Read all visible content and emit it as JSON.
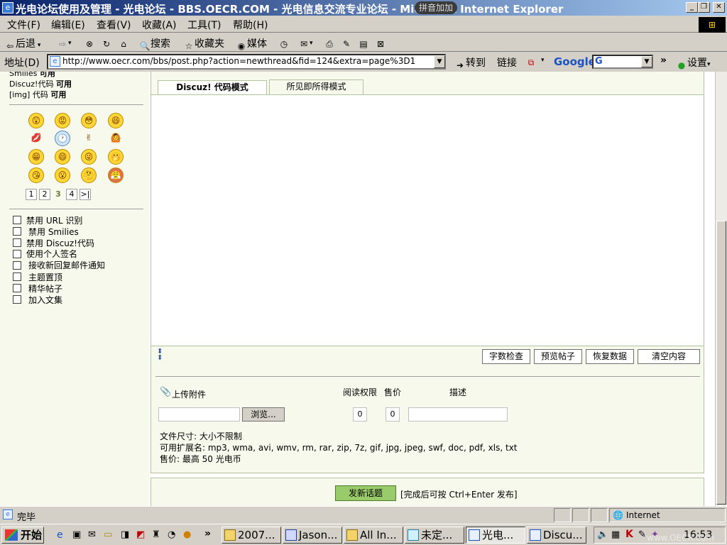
{
  "window": {
    "title": "光电论坛使用及管理 - 光电论坛 - BBS.OECR.COM - 光电信息交流专业论坛 - Microsoft Internet Explorer",
    "ime_label": "拼音加加"
  },
  "menu": [
    "文件(F)",
    "编辑(E)",
    "查看(V)",
    "收藏(A)",
    "工具(T)",
    "帮助(H)"
  ],
  "toolbar": {
    "back": "后退",
    "search": "搜索",
    "favorites": "收藏夹",
    "media": "媒体"
  },
  "address": {
    "label": "地址(D)",
    "url": "http://www.oecr.com/bbs/post.php?action=newthread&fid=124&extra=page%3D1",
    "go": "转到",
    "links": "链接",
    "google": "Google",
    "settings": "设置"
  },
  "sidebar": {
    "status": [
      {
        "name": "Smilies",
        "value": "可用"
      },
      {
        "name": "Discuz!代码",
        "value": "可用"
      },
      {
        "name": "[img] 代码",
        "value": "可用"
      }
    ],
    "smilies": [
      "😲",
      "😡",
      "😳",
      "😆",
      "💋",
      "🕐",
      "✌",
      "🙆",
      "😁",
      "😄",
      "😜",
      "🤭",
      "😘",
      "😮",
      "🤔",
      "😤"
    ],
    "pages": [
      "1",
      "2",
      "3",
      "4",
      ">|"
    ],
    "current_page": "3",
    "options": [
      "禁用 URL 识别",
      "禁用 Smilies",
      "禁用 Discuz!代码",
      "使用个人签名",
      "接收新回复邮件通知",
      "主题置顶",
      "精华帖子",
      "加入文集"
    ]
  },
  "editor": {
    "tab_code": "Discuz! 代码模式",
    "tab_wysiwyg": "所见即所得模式",
    "buttons": {
      "count": "字数检查",
      "preview": "预览帖子",
      "restore": "恢复数据",
      "clear": "清空内容"
    }
  },
  "attachment": {
    "label": "上传附件",
    "col_perm": "阅读权限",
    "col_price": "售价",
    "col_desc": "描述",
    "browse": "浏览...",
    "perm_value": "0",
    "price_value": "0",
    "info": [
      "文件尺寸: 大小不限制",
      "可用扩展名: mp3, wma, avi, wmv, rm, rar, zip, 7z, gif, jpg, jpeg, swf, doc, pdf, xls, txt",
      "售价: 最高 50 光电币"
    ]
  },
  "submit": {
    "button": "发新话题",
    "hint": "[完成后可按 Ctrl+Enter 发布]"
  },
  "status": {
    "text": "完毕",
    "zone": "Internet"
  },
  "taskbar": {
    "start": "开始",
    "tasks": [
      "2007...",
      "Jason...",
      "All In...",
      "未定...",
      "光电...",
      "Discu..."
    ],
    "active_task": "光电...",
    "clock": "16:53",
    "watermark": "www.OECR.com"
  }
}
